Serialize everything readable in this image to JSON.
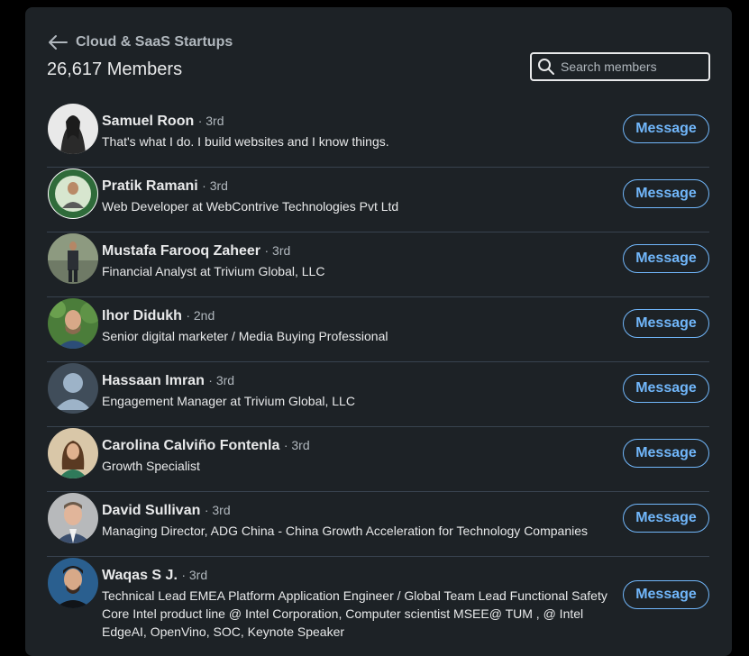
{
  "header": {
    "group_name": "Cloud & SaaS Startups",
    "members_count": "26,617 Members",
    "search_placeholder": "Search members"
  },
  "members": [
    {
      "name": "Samuel Roon",
      "degree": "· 3rd",
      "headline": "That's what I do. I build websites and I know things.",
      "button": "Message"
    },
    {
      "name": "Pratik Ramani",
      "degree": "· 3rd",
      "headline": "Web Developer at WebContrive Technologies Pvt Ltd",
      "button": "Message"
    },
    {
      "name": "Mustafa Farooq Zaheer",
      "degree": "· 3rd",
      "headline": "Financial Analyst at Trivium Global, LLC",
      "button": "Message"
    },
    {
      "name": "Ihor Didukh",
      "degree": "· 2nd",
      "headline": "Senior digital marketer / Media Buying Professional",
      "button": "Message"
    },
    {
      "name": "Hassaan Imran",
      "degree": "· 3rd",
      "headline": "Engagement Manager at Trivium Global, LLC",
      "button": "Message"
    },
    {
      "name": "Carolina Calviño Fontenla",
      "degree": "· 3rd",
      "headline": "Growth Specialist",
      "button": "Message"
    },
    {
      "name": "David Sullivan",
      "degree": "· 3rd",
      "headline": "Managing Director, ADG China - China Growth Acceleration for Technology Companies",
      "button": "Message"
    },
    {
      "name": "Waqas S J.",
      "degree": "· 3rd",
      "headline": "Technical Lead EMEA Platform Application Engineer / Global Team Lead Functional Safety Core Intel product line @ Intel Corporation, Computer scientist MSEE@ TUM , @ Intel EdgeAI, OpenVino, SOC, Keynote Speaker",
      "button": "Message"
    }
  ],
  "colors": {
    "card_bg": "#1d2226",
    "accent": "#71b7fb",
    "divider": "#38434f"
  }
}
